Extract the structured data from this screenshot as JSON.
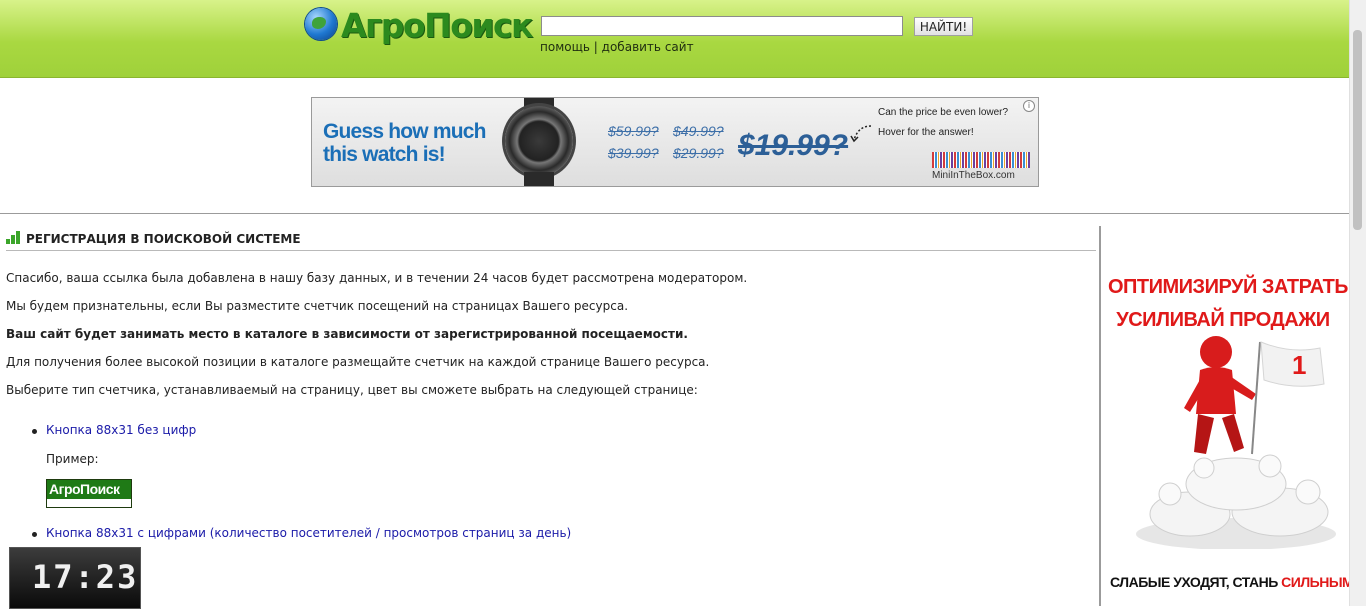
{
  "header": {
    "logo_text": "АгроПоиск",
    "search": {
      "value": "",
      "placeholder": ""
    },
    "search_button": "НАЙТИ!",
    "links": {
      "help": "помощь",
      "separator": "|",
      "add_site": "добавить сайт"
    }
  },
  "banner": {
    "title": "Guess how much this watch is!",
    "prices": [
      "$59.99?",
      "$49.99?",
      "$39.99?",
      "$29.99?"
    ],
    "big_price": "$19.99?",
    "question": "Can the price be even lower?",
    "hover": "Hover for the answer!",
    "brand": "MiniInTheBox.com",
    "info": "i"
  },
  "section": {
    "title": "РЕГИСТРАЦИЯ В ПОИСКОВОЙ СИСТЕМЕ"
  },
  "paragraphs": [
    "Спасибо, ваша ссылка была добавлена в нашу базу данных, и в течении 24 часов будет рассмотрена модератором.",
    "Мы будем признательны, если Вы разместите счетчик посещений на страницах Вашего ресурса.",
    "Ваш сайт будет занимать место в каталоге в зависимости от зарегистрированной посещаемости.",
    "Для получения более высокой позиции в каталоге размещайте счетчик на каждой странице Вашего ресурса.",
    "Выберите тип счетчика, устанавливаемый на страницу, цвет вы сможете выбрать на следующей странице:"
  ],
  "counters": {
    "option1": "Кнопка 88x31 без цифр",
    "example_label": "Пример:",
    "example_button": "АгроПоиск",
    "option2": "Кнопка 88x31 с цифрами (количество посетителей / просмотров страниц за день)",
    "clock_text": "17:23"
  },
  "side_ad": {
    "line1": "ОПТИМИЗИРУЙ ЗАТРАТЫ",
    "line2": "УСИЛИВАЙ ПРОДАЖИ",
    "flag_number": "1",
    "bottom_prefix": "СЛАБЫЕ УХОДЯТ, СТАНЬ ",
    "bottom_highlight": "СИЛЬНЫМ",
    "bottom_suffix": "!"
  },
  "colors": {
    "header_green": "#a9d841",
    "link_blue": "#1a1aa8",
    "ad_red": "#e01919"
  }
}
